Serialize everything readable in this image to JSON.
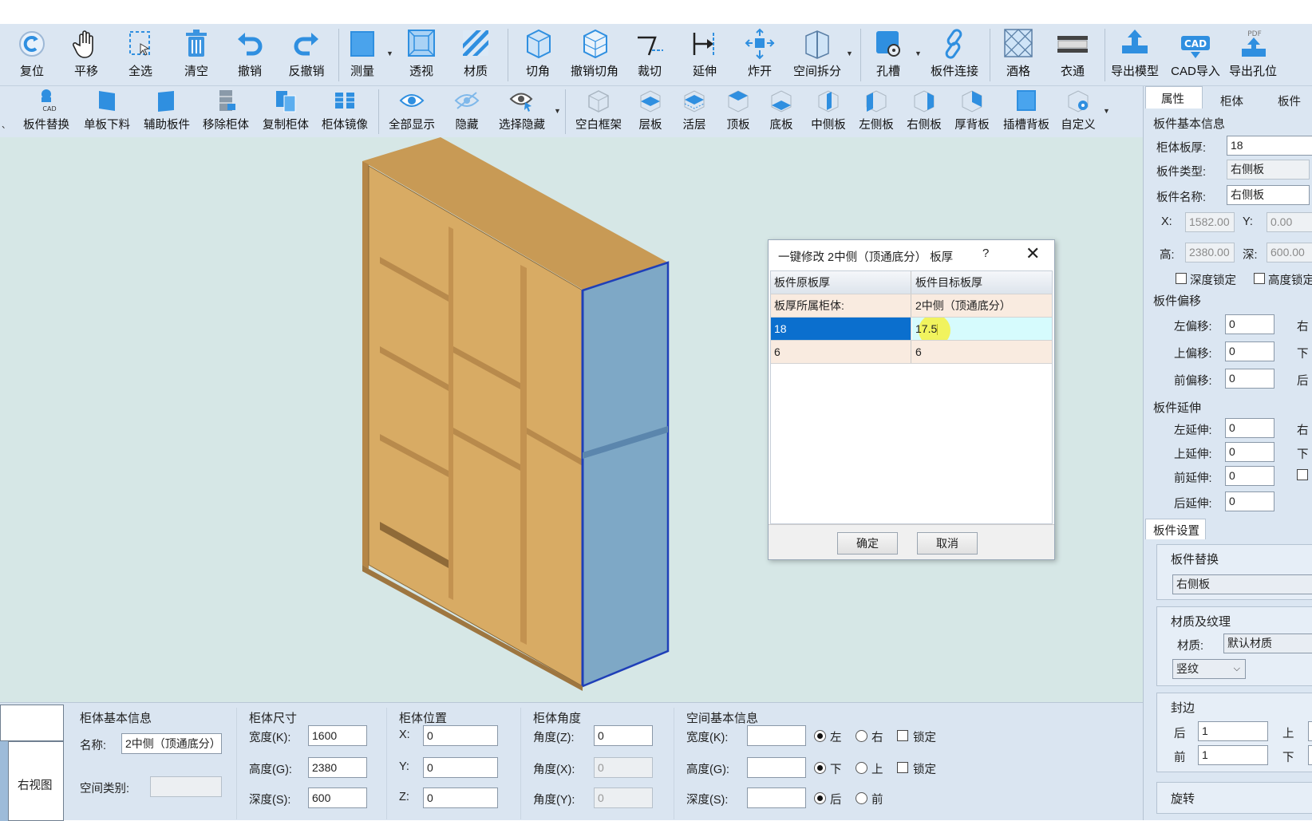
{
  "toolbar1": [
    {
      "id": "reset",
      "label": "复位",
      "icon": "reset-icon"
    },
    {
      "id": "pan",
      "label": "平移",
      "icon": "hand-icon"
    },
    {
      "id": "select-all",
      "label": "全选",
      "icon": "select-all-icon"
    },
    {
      "id": "clear",
      "label": "清空",
      "icon": "trash-icon"
    },
    {
      "id": "undo",
      "label": "撤销",
      "icon": "undo-icon"
    },
    {
      "id": "redo",
      "label": "反撤销",
      "icon": "redo-icon"
    },
    {
      "id": "measure",
      "label": "测量",
      "icon": "measure-icon"
    },
    {
      "id": "perspective",
      "label": "透视",
      "icon": "perspective-icon"
    },
    {
      "id": "material",
      "label": "材质",
      "icon": "material-icon"
    },
    {
      "id": "cut-corner",
      "label": "切角",
      "icon": "cut-corner-icon"
    },
    {
      "id": "undo-cut-corner",
      "label": "撤销切角",
      "icon": "undo-cut-corner-icon"
    },
    {
      "id": "trim",
      "label": "裁切",
      "icon": "trim-icon"
    },
    {
      "id": "extend",
      "label": "延伸",
      "icon": "extend-icon"
    },
    {
      "id": "explode",
      "label": "炸开",
      "icon": "explode-icon"
    },
    {
      "id": "space-split",
      "label": "空间拆分",
      "icon": "space-split-icon"
    },
    {
      "id": "slot",
      "label": "孔槽",
      "icon": "slot-icon"
    },
    {
      "id": "panel-connect",
      "label": "板件连接",
      "icon": "link-icon"
    },
    {
      "id": "wine-rack",
      "label": "酒格",
      "icon": "wine-rack-icon"
    },
    {
      "id": "wardrobe-rod",
      "label": "衣通",
      "icon": "wardrobe-rod-icon"
    },
    {
      "id": "export-model",
      "label": "导出模型",
      "icon": "export-model-icon"
    },
    {
      "id": "cad-import",
      "label": "CAD导入",
      "icon": "cad-import-icon"
    },
    {
      "id": "export-holes",
      "label": "导出孔位",
      "icon": "export-holes-icon"
    }
  ],
  "toolbar2": [
    {
      "id": "panel-replace",
      "label": "板件替换",
      "icon": "panel-replace-icon"
    },
    {
      "id": "single-cut",
      "label": "单板下料",
      "icon": "single-panel-icon"
    },
    {
      "id": "aux-panel",
      "label": "辅助板件",
      "icon": "aux-panel-icon"
    },
    {
      "id": "remove-cabinet",
      "label": "移除柜体",
      "icon": "remove-cabinet-icon"
    },
    {
      "id": "copy-cabinet",
      "label": "复制柜体",
      "icon": "copy-cabinet-icon"
    },
    {
      "id": "mirror-cabinet",
      "label": "柜体镜像",
      "icon": "mirror-cabinet-icon"
    },
    {
      "id": "show-all",
      "label": "全部显示",
      "icon": "eye-icon"
    },
    {
      "id": "hide",
      "label": "隐藏",
      "icon": "eye-off-icon"
    },
    {
      "id": "select-hide",
      "label": "选择隐藏",
      "icon": "select-hide-icon"
    },
    {
      "id": "blank-frame",
      "label": "空白框架",
      "icon": "blank-frame-icon"
    },
    {
      "id": "shelf",
      "label": "层板",
      "icon": "shelf-icon"
    },
    {
      "id": "movable-shelf",
      "label": "活层",
      "icon": "movable-shelf-icon"
    },
    {
      "id": "top-panel",
      "label": "顶板",
      "icon": "top-panel-icon"
    },
    {
      "id": "bottom-panel",
      "label": "底板",
      "icon": "bottom-panel-icon"
    },
    {
      "id": "mid-side",
      "label": "中侧板",
      "icon": "mid-side-icon"
    },
    {
      "id": "left-side",
      "label": "左侧板",
      "icon": "left-side-icon"
    },
    {
      "id": "right-side",
      "label": "右侧板",
      "icon": "right-side-icon"
    },
    {
      "id": "thick-back",
      "label": "厚背板",
      "icon": "thick-back-icon"
    },
    {
      "id": "slot-back",
      "label": "插槽背板",
      "icon": "slot-back-icon"
    },
    {
      "id": "custom",
      "label": "自定义",
      "icon": "custom-icon"
    }
  ],
  "dialog": {
    "title": "一键修改 2中侧（顶通底分） 板厚",
    "help": "?",
    "close": "✕",
    "col1": "板件原板厚",
    "col2": "板件目标板厚",
    "rows": [
      {
        "c1": "板厚所属柜体:",
        "c2": "2中侧（顶通底分）"
      },
      {
        "c1": "18",
        "c2": "17.5"
      },
      {
        "c1": "6",
        "c2": "6"
      }
    ],
    "ok": "确定",
    "cancel": "取消"
  },
  "bottom": {
    "view_tab": "右视图",
    "cab_info_title": "柜体基本信息",
    "name_label": "名称:",
    "name_value": "2中侧（顶通底分）",
    "space_type_label": "空间类别:",
    "size_title": "柜体尺寸",
    "width_label": "宽度(K):",
    "width_value": "1600",
    "height_label": "高度(G):",
    "height_value": "2380",
    "depth_label": "深度(S):",
    "depth_value": "600",
    "pos_title": "柜体位置",
    "x_label": "X:",
    "x_value": "0",
    "y_label": "Y:",
    "y_value": "0",
    "z_label": "Z:",
    "z_value": "0",
    "angle_title": "柜体角度",
    "az_label": "角度(Z):",
    "az_value": "0",
    "ax_label": "角度(X):",
    "ax_value": "0",
    "ay_label": "角度(Y):",
    "ay_value": "0",
    "space_title": "空间基本信息",
    "sw_label": "宽度(K):",
    "sh_label": "高度(G):",
    "sd_label": "深度(S):",
    "left": "左",
    "right": "右",
    "down": "下",
    "up": "上",
    "back": "后",
    "front": "前",
    "lock": "锁定"
  },
  "right_panel": {
    "tabs": [
      "属性",
      "柜体",
      "板件"
    ],
    "basic_title": "板件基本信息",
    "thickness_label": "柜体板厚:",
    "thickness_value": "18",
    "type_label": "板件类型:",
    "type_value": "右侧板",
    "name_label": "板件名称:",
    "name_value": "右侧板",
    "x_label": "X:",
    "x_value": "1582.00",
    "y_label": "Y:",
    "y_value": "0.00",
    "h_label": "高:",
    "h_value": "2380.00",
    "d_label": "深:",
    "d_value": "600.00",
    "depth_lock": "深度锁定",
    "height_lock": "高度锁定",
    "offset_title": "板件偏移",
    "left_off": "左偏移:",
    "left_off_value": "0",
    "up_off": "上偏移:",
    "up_off_value": "0",
    "front_off": "前偏移:",
    "front_off_value": "0",
    "right_off_partial": "右",
    "down_off_partial": "下",
    "back_off_partial": "后",
    "extend_title": "板件延伸",
    "left_ext": "左延伸:",
    "left_ext_value": "0",
    "up_ext": "上延伸:",
    "up_ext_value": "0",
    "front_ext": "前延伸:",
    "front_ext_value": "0",
    "back_ext": "后延伸:",
    "back_ext_value": "0",
    "right_ext_partial": "右",
    "down_ext_partial": "下",
    "settings_tab": "板件设置",
    "replace_title": "板件替换",
    "replace_value": "右侧板",
    "material_title": "材质及纹理",
    "material_label": "材质:",
    "material_value": "默认材质",
    "grain_value": "竖纹",
    "edge_title": "封边",
    "edge_back": "后",
    "edge_back_value": "1",
    "edge_front": "前",
    "edge_front_value": "1",
    "edge_up": "上",
    "edge_down": "下",
    "rotate_title": "旋转"
  },
  "colors": {
    "toolbar_bg": "#dbe6f2",
    "viewport_bg": "#d6e7e6",
    "selection_blue": "#0b6fce",
    "wood": "#d9ad62",
    "highlight_panel": "#6f9cc0"
  }
}
